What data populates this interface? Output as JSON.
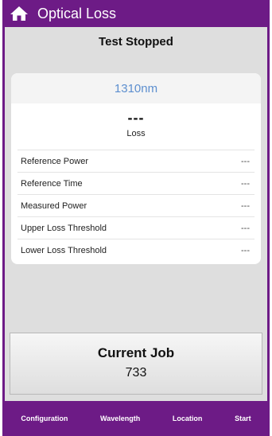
{
  "header": {
    "title": "Optical Loss",
    "icon": "home-icon"
  },
  "status": "Test Stopped",
  "result": {
    "wavelength": "1310nm",
    "loss_value": "---",
    "loss_label": "Loss",
    "rows": [
      {
        "label": "Reference Power",
        "value": "---"
      },
      {
        "label": "Reference Time",
        "value": "---"
      },
      {
        "label": "Measured Power",
        "value": "---"
      },
      {
        "label": "Upper Loss Threshold",
        "value": "---"
      },
      {
        "label": "Lower Loss Threshold",
        "value": "---"
      }
    ]
  },
  "job": {
    "title": "Current Job",
    "number": "733"
  },
  "nav": [
    {
      "label": "Configuration"
    },
    {
      "label": "Wavelength"
    },
    {
      "label": "Location"
    },
    {
      "label": "Start"
    }
  ],
  "colors": {
    "brand": "#6d1b86",
    "wavelength_text": "#5d8fcf",
    "background": "#dedede"
  }
}
